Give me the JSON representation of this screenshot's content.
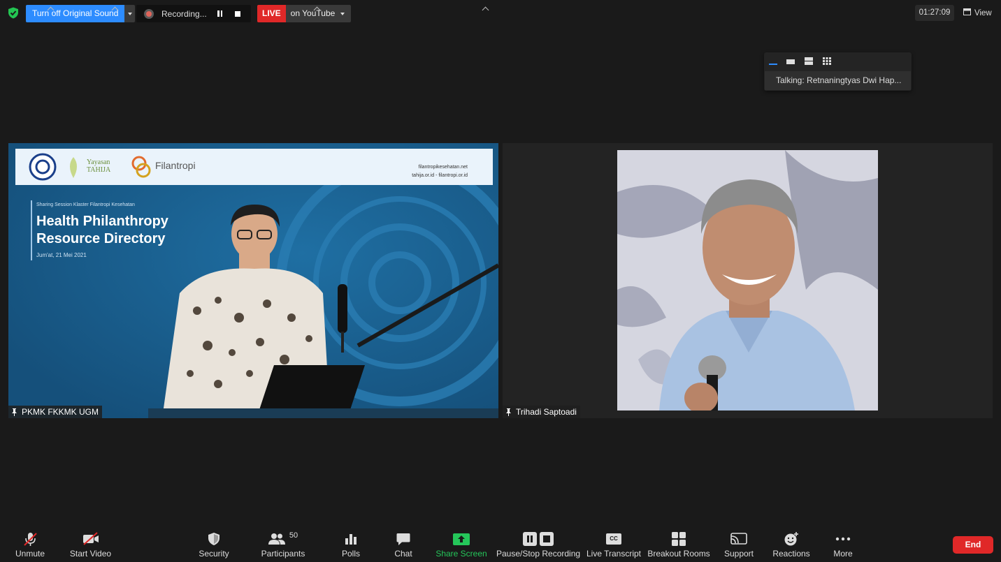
{
  "top_bar": {
    "original_sound_label": "Turn off Original Sound",
    "recording_label": "Recording...",
    "live_label": "LIVE",
    "live_destination": "on YouTube",
    "timer": "01:27:09",
    "view_label": "View"
  },
  "layout_popover": {
    "talking_label": "Talking:",
    "talking_name": "Retnaningtyas  Dwi  Hap..."
  },
  "tiles": [
    {
      "name": "PKMK FKKMK UGM",
      "slide": {
        "kicker": "Sharing Session Klaster Filantropi Kesehatan",
        "title_line1": "Health Philanthropy",
        "title_line2": "Resource Directory",
        "date": "Jum'at, 21 Mei 2021",
        "logo_text_1": "Yayasan",
        "logo_text_2": "TAHIJA",
        "logo_text_3": "Filantropi",
        "web_1": "filantropikesehatan.net",
        "web_2": "tahija.or.id  -  filantropi.or.id"
      }
    },
    {
      "name": "Trihadi Saptoadi"
    }
  ],
  "toolbar": {
    "unmute": "Unmute",
    "start_video": "Start Video",
    "security": "Security",
    "participants": "Participants",
    "participants_count": "50",
    "polls": "Polls",
    "chat": "Chat",
    "share_screen": "Share Screen",
    "pause_stop_recording": "Pause/Stop Recording",
    "live_transcript": "Live Transcript",
    "live_transcript_icon_text": "CC",
    "breakout_rooms": "Breakout Rooms",
    "support": "Support",
    "reactions": "Reactions",
    "more": "More",
    "end": "End"
  },
  "colors": {
    "background": "#1a1a1a",
    "accent_blue": "#2d8cff",
    "live_red": "#e02828",
    "share_green": "#25c65a"
  },
  "icons": [
    "shield-check-icon",
    "microphone-muted-icon",
    "video-off-icon",
    "shield-icon",
    "participants-icon",
    "polls-icon",
    "chat-icon",
    "share-screen-icon",
    "pause-icon",
    "stop-icon",
    "cc-icon",
    "breakout-rooms-icon",
    "cast-icon",
    "reaction-smiley-icon",
    "more-dots-icon",
    "pin-icon",
    "view-icon"
  ]
}
